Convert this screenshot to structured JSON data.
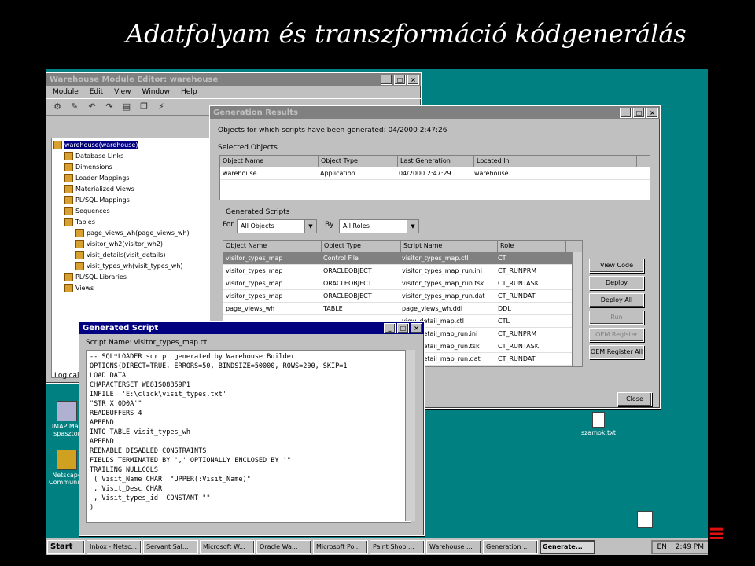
{
  "slide": {
    "title": "Adatfolyam és transzformáció kódgenerálás"
  },
  "module_editor": {
    "title": "Warehouse Module Editor: warehouse",
    "menu": [
      "Module",
      "Edit",
      "View",
      "Window",
      "Help"
    ],
    "tree": [
      "warehouse(warehouse)",
      "Database Links",
      "Dimensions",
      "Loader Mappings",
      "Materialized Views",
      "PL/SQL Mappings",
      "Sequences",
      "Tables",
      "page_views_wh(page_views_wh)",
      "visitor_wh2(visitor_wh2)",
      "visit_details(visit_details)",
      "visit_types_wh(visit_types_wh)",
      "PL/SQL Libraries",
      "Views"
    ],
    "status": "Logical"
  },
  "generation_results": {
    "title": "Generation Results",
    "generated_line": "Objects for which scripts have been generated: 04/2000 2:47:26",
    "selected_objects_label": "Selected Objects",
    "columns": [
      "Object Name",
      "Object Type",
      "Last Generation",
      "Located In"
    ],
    "rows": [
      [
        "warehouse",
        "Application",
        "04/2000 2:47:29",
        "warehouse"
      ]
    ],
    "scripts_group_label": "Generated Scripts",
    "for_label": "For",
    "for_value": "All Objects",
    "by_label": "By",
    "by_value": "All Roles",
    "script_columns": [
      "Object Name",
      "Object Type",
      "Script Name",
      "Role"
    ],
    "script_rows": [
      [
        "visitor_types_map",
        "Control File",
        "visitor_types_map.ctl",
        "CT"
      ],
      [
        "visitor_types_map",
        "ORACLEOBJECT",
        "visitor_types_map_run.ini",
        "CT_RUNPRM"
      ],
      [
        "visitor_types_map",
        "ORACLEOBJECT",
        "visitor_types_map_run.tsk",
        "CT_RUNTASK"
      ],
      [
        "visitor_types_map",
        "ORACLEOBJECT",
        "visitor_types_map_run.dat",
        "CT_RUNDAT"
      ],
      [
        "page_views_wh",
        "TABLE",
        "page_views_wh.ddl",
        "DDL"
      ],
      [
        "",
        "",
        "view_detail_map.ctl",
        "CTL"
      ],
      [
        "",
        "",
        "view_detail_map_run.ini",
        "CT_RUNPRM"
      ],
      [
        "",
        "",
        "view_detail_map_run.tsk",
        "CT_RUNTASK"
      ],
      [
        "",
        "",
        "view_detail_map_run.dat",
        "CT_RUNDAT"
      ]
    ],
    "buttons": [
      "View Code",
      "Deploy",
      "Deploy All",
      "Run",
      "OEM Register",
      "OEM Register All"
    ],
    "close_label": "Close"
  },
  "generated_script": {
    "title": "Generated Script",
    "script_name_label": "Script Name: visitor_types_map.ctl",
    "lines": [
      "-- SQL*LOADER script generated by Warehouse Builder",
      "OPTIONS(DIRECT=TRUE, ERRORS=50, BINDSIZE=50000, ROWS=200, SKIP=1",
      "LOAD DATA",
      "CHARACTERSET WE8ISO8859P1",
      "INFILE  'E:\\click\\visit_types.txt'",
      "\"STR X'0D0A'\"",
      "READBUFFERS 4",
      "APPEND",
      "INTO TABLE visit_types_wh",
      "APPEND",
      "REENABLE DISABLED_CONSTRAINTS",
      "FIELDS TERMINATED BY ',' OPTIONALLY ENCLOSED BY '\"'",
      "TRAILING NULLCOLS",
      " ( Visit_Name CHAR  \"UPPER(:Visit_Name)\"",
      " , Visit_Desc CHAR",
      " , Visit_types_id  CONSTANT \"\"",
      ")"
    ]
  },
  "desktop_icons": [
    {
      "label": "IMAP Mail spasztor",
      "icon": "mail-icon"
    },
    {
      "label": "Netscape Communicator",
      "icon": "netscape-icon"
    },
    {
      "label": "szamok.txt",
      "icon": "text-file-icon"
    }
  ],
  "taskbar": {
    "start_label": "Start",
    "tasks": [
      "Inbox - Netsc...",
      "Servant Sal...",
      "Microsoft W...",
      "Oracle Wa...",
      "Microsoft Po...",
      "Paint Shop ...",
      "Warehouse ...",
      "Generation ...",
      "Generate..."
    ],
    "active_task_index": 8,
    "clock": "2:49 PM",
    "lang": "EN"
  }
}
